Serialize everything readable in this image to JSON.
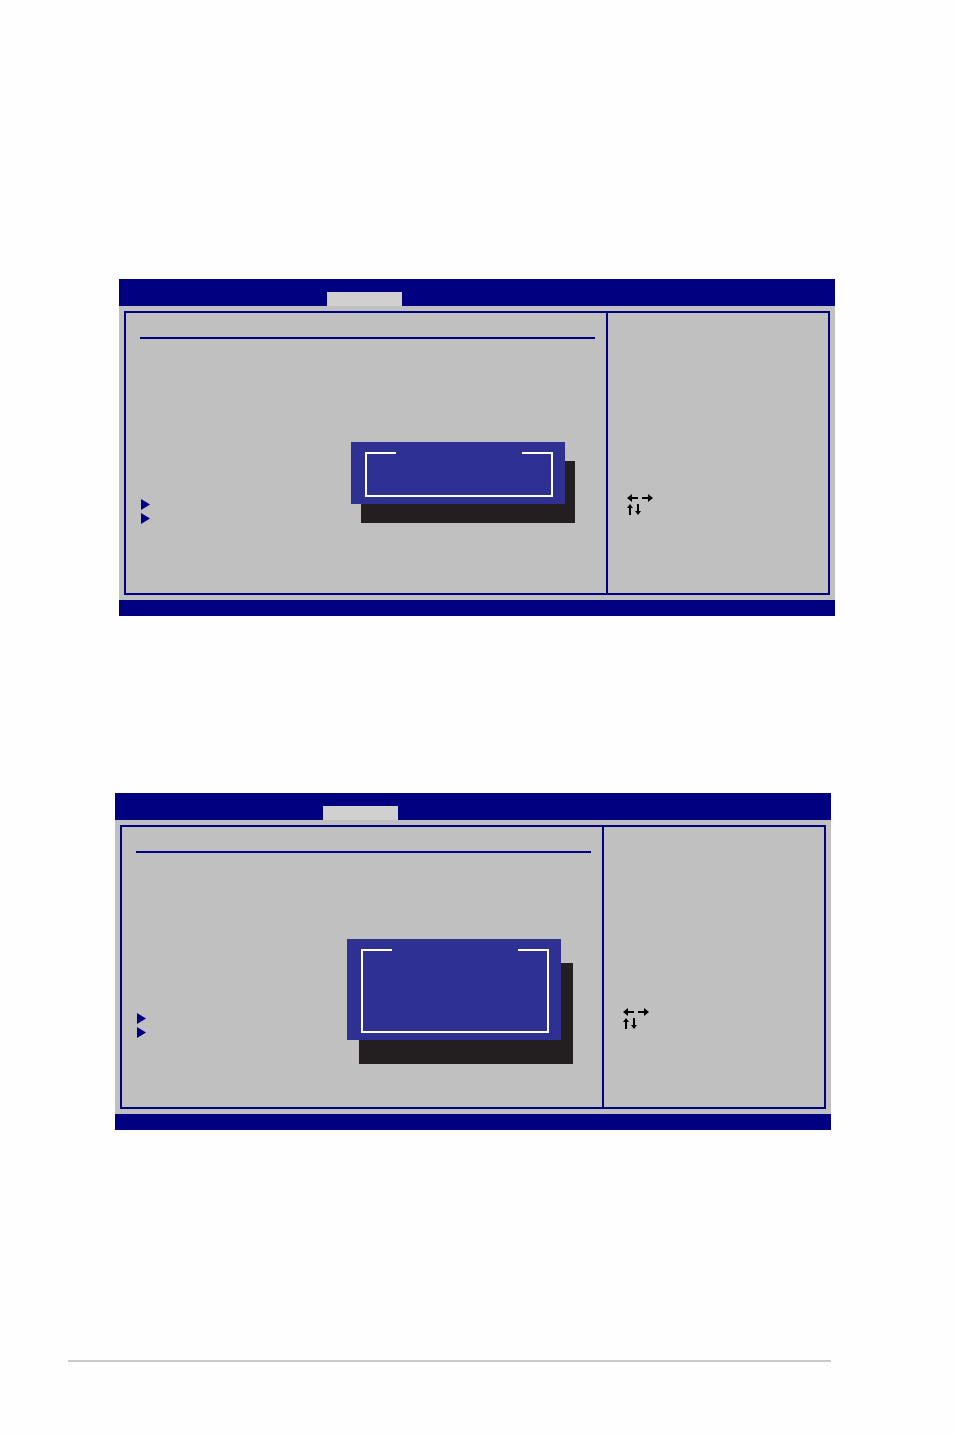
{
  "screens": [
    {
      "tabs": [
        {
          "selected": true
        }
      ],
      "menu_items": [
        {
          "kind": "submenu"
        },
        {
          "kind": "submenu"
        }
      ],
      "dialog": {
        "kind": "single"
      }
    },
    {
      "tabs": [
        {
          "selected": true
        }
      ],
      "menu_items": [
        {
          "kind": "submenu"
        },
        {
          "kind": "submenu"
        }
      ],
      "dialog": {
        "kind": "multi"
      }
    }
  ]
}
